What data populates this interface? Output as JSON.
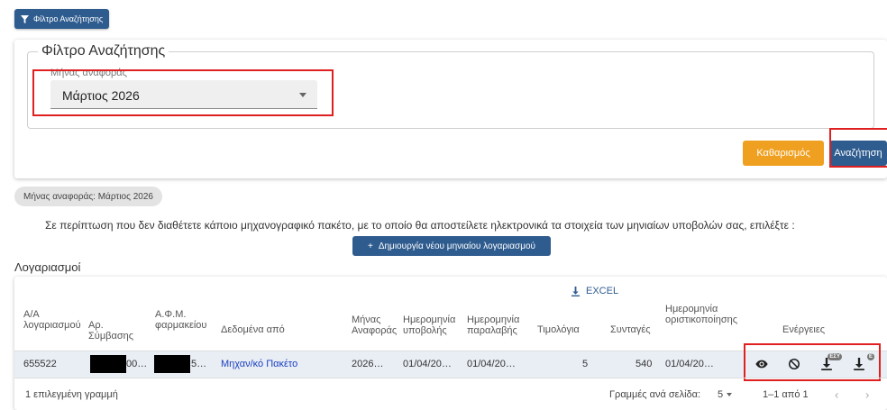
{
  "top_button": {
    "label": "Φίλτρο Αναζήτησης"
  },
  "filter": {
    "legend": "Φίλτρο Αναζήτησης",
    "month_label": "Μήνας αναφοράς",
    "month_value": "Μάρτιος 2026",
    "clear_label": "Καθαρισμός",
    "search_label": "Αναζήτηση"
  },
  "chip": "Μήνας αναφοράς: Μάρτιος 2026",
  "notice": "Σε περίπτωση που δεν διαθέτετε κάποιο μηχανογραφικό πακέτο, με το οποίο θα αποστείλετε ηλεκτρονικά τα στοιχεία των μηνιαίων υποβολών σας, επιλέξτε :",
  "new_button": {
    "icon": "+",
    "label": "Δημιουργία νέου μηνιαίου λογαριασμού"
  },
  "section_title": "Λογαριασμοί",
  "table": {
    "excel_label": "EXCEL",
    "headers": {
      "account_no": "Α/Α λογαριασμού",
      "contract_no": "Αρ. Σύμβασης",
      "pharmacy_vat": "Α.Φ.Μ. φαρμακείου",
      "data_from": "Δεδομένα από",
      "ref_month": "Μήνας Αναφοράς",
      "submit_date": "Ημερομηνία υποβολής",
      "receipt_date": "Ημερομηνία παραλαβής",
      "invoices": "Τιμολόγια",
      "prescriptions": "Συνταγές",
      "final_date": "Ημερομηνία οριστικοποίησης",
      "actions": "Ενέργειες"
    },
    "row": {
      "account_no": "655522",
      "contract_no_suffix": "00…",
      "pharmacy_vat_suffix": "5…",
      "data_from": "Μηχαν/κό Πακέτο",
      "ref_month": "2026…",
      "submit_date": "01/04/20…",
      "receipt_date": "01/04/20…",
      "invoices": "5",
      "prescriptions": "540",
      "final_date": "01/04/20…"
    },
    "action_badges": {
      "download_esy": "ΕΣΥ",
      "download_e": "E"
    },
    "footer": {
      "selected": "1 επιλεγμένη γραμμή",
      "rows_per_page_label": "Γραμμές ανά σελίδα:",
      "rows_per_page": "5",
      "range": "1–1 από 1",
      "prev": "‹",
      "next": "›"
    }
  }
}
